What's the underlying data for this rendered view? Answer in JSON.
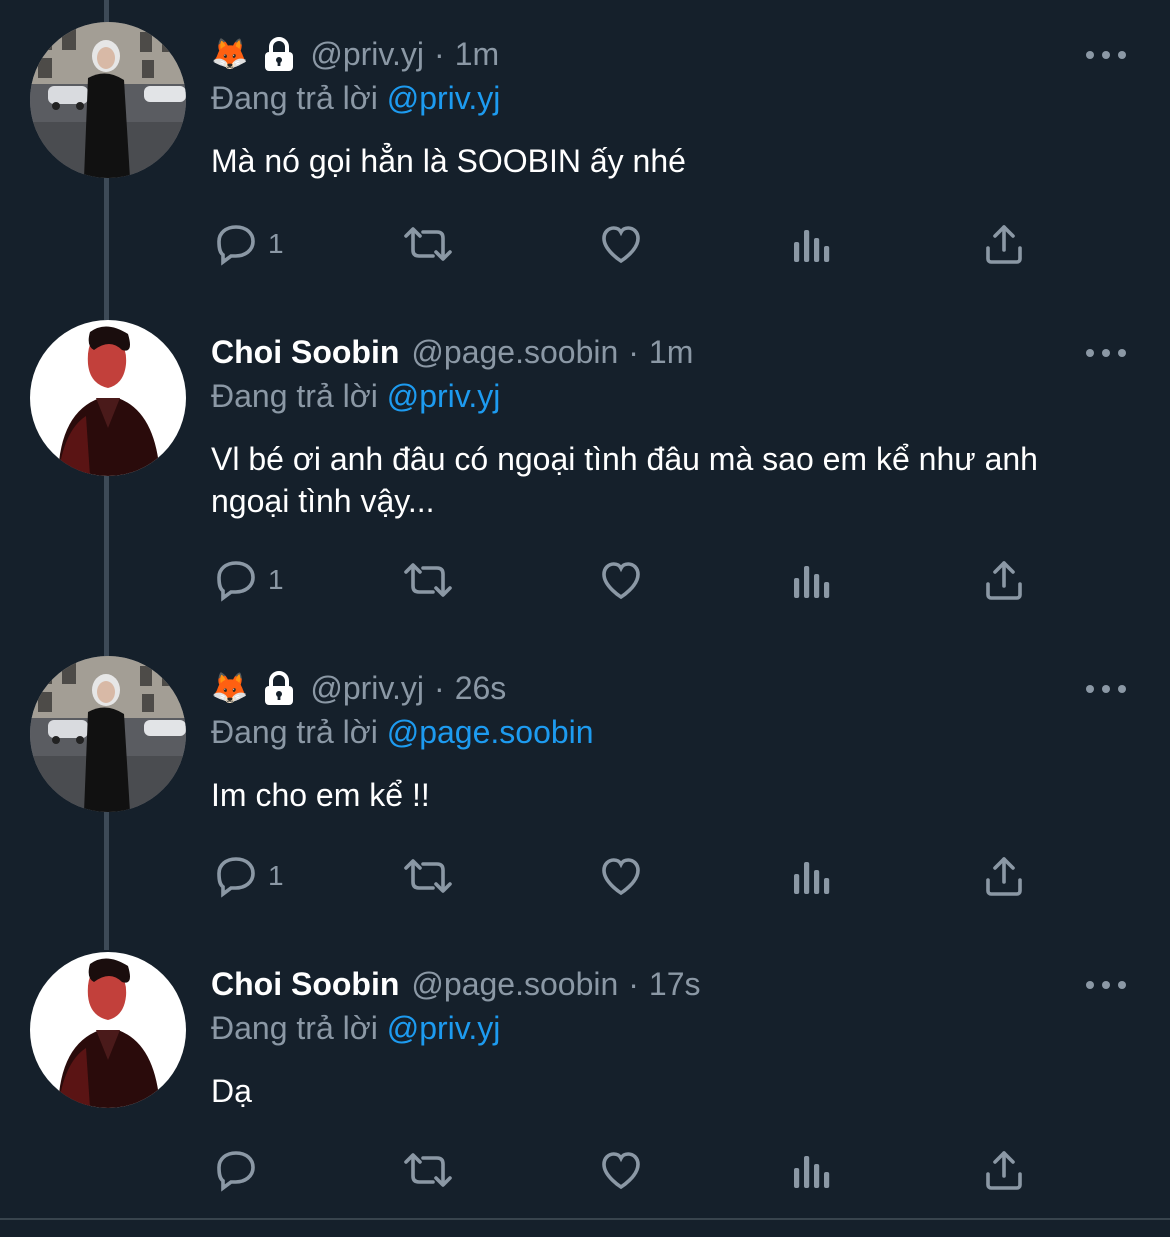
{
  "tweets": [
    {
      "avatar": "street-photo-avatar",
      "show_name": false,
      "name": "",
      "emoji": "🦊",
      "locked": true,
      "handle": "@priv.yj",
      "time": "1m",
      "reply_prefix": "Đang trả lời",
      "reply_to": "@priv.yj",
      "text": "Mà nó gọi hẳn là SOOBIN ấy nhé",
      "reply_count": "1"
    },
    {
      "avatar": "portrait-red-avatar",
      "show_name": true,
      "name": "Choi Soobin",
      "emoji": "",
      "locked": false,
      "handle": "@page.soobin",
      "time": "1m",
      "reply_prefix": "Đang trả lời",
      "reply_to": "@priv.yj",
      "text": "Vl bé ơi anh đâu có ngoại tình đâu mà sao em kể như anh ngoại tình vậy...",
      "reply_count": "1"
    },
    {
      "avatar": "street-photo-avatar",
      "show_name": false,
      "name": "",
      "emoji": "🦊",
      "locked": true,
      "handle": "@priv.yj",
      "time": "26s",
      "reply_prefix": "Đang trả lời",
      "reply_to": "@page.soobin",
      "text": "Im cho em kể !!",
      "reply_count": "1"
    },
    {
      "avatar": "portrait-red-avatar",
      "show_name": true,
      "name": "Choi Soobin",
      "emoji": "",
      "locked": false,
      "handle": "@page.soobin",
      "time": "17s",
      "reply_prefix": "Đang trả lời",
      "reply_to": "@priv.yj",
      "text": "Dạ",
      "reply_count": ""
    }
  ],
  "colors": {
    "background": "#15202b",
    "text": "#ffffff",
    "secondary": "#8b98a5",
    "link": "#1d9bf0"
  },
  "icons": [
    "reply-icon",
    "retweet-icon",
    "like-icon",
    "analytics-icon",
    "share-icon",
    "more-icon",
    "lock-icon"
  ]
}
